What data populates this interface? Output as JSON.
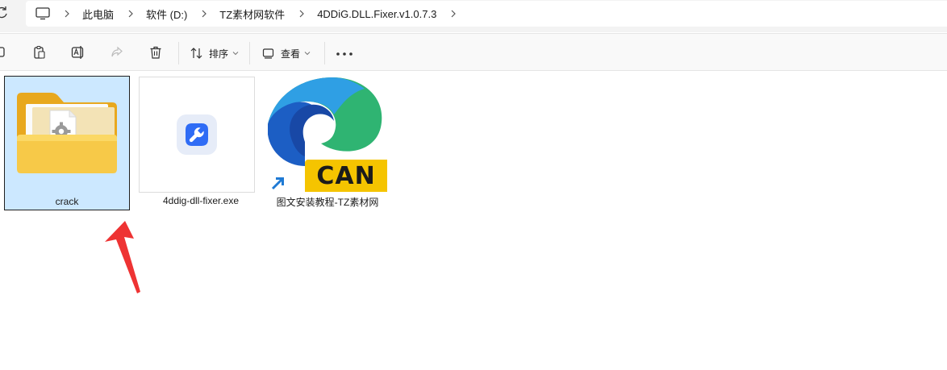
{
  "address_bar": {
    "breadcrumbs": [
      {
        "label": "此电脑"
      },
      {
        "label": "软件 (D:)"
      },
      {
        "label": "TZ素材网软件"
      },
      {
        "label": "4DDiG.DLL.Fixer.v1.0.7.3"
      }
    ]
  },
  "toolbar": {
    "sort_label": "排序",
    "view_label": "查看"
  },
  "files": [
    {
      "name": "crack",
      "type": "folder",
      "selected": true
    },
    {
      "name": "4ddig-dll-fixer.exe",
      "type": "exe",
      "selected": false
    },
    {
      "name": "图文安装教程-TZ素材网",
      "type": "shortcut",
      "selected": false,
      "badge_text": "CAN"
    }
  ],
  "colors": {
    "selection": "#cce8ff",
    "badge": "#f5c400",
    "annotation_arrow": "#ee3333"
  }
}
